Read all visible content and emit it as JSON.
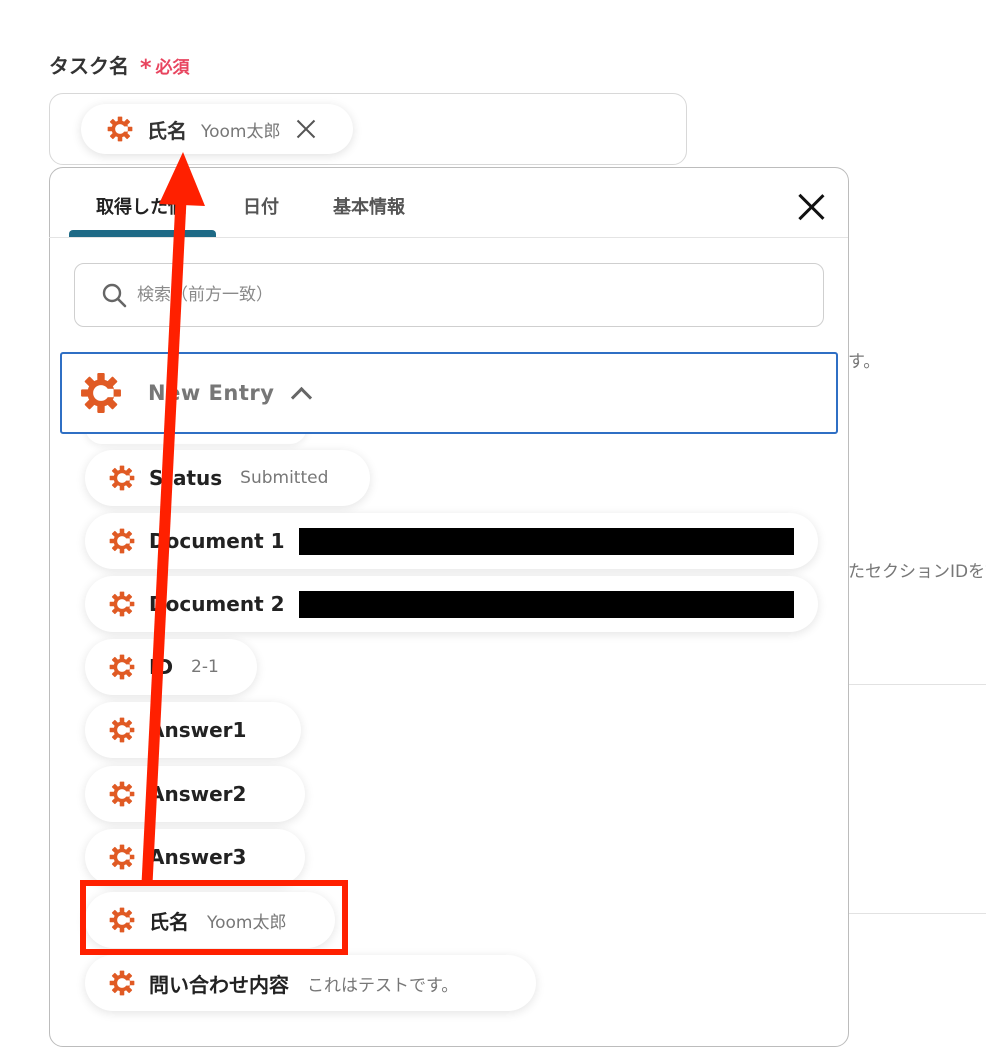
{
  "field": {
    "label": "タスク名",
    "required_mark": "*",
    "required_text": "必須",
    "chip": {
      "name": "氏名",
      "value": "Yoom太郎"
    }
  },
  "background": {
    "text1": "す。",
    "text2": "たセクションIDを設"
  },
  "panel": {
    "tabs": [
      {
        "label": "取得した値",
        "active": true
      },
      {
        "label": "日付",
        "active": false
      },
      {
        "label": "基本情報",
        "active": false
      }
    ],
    "search_placeholder": "検索（前方一致）",
    "group": {
      "title": "New Entry",
      "items": [
        {
          "name": "Status",
          "value": "Submitted"
        },
        {
          "name": "Document 1",
          "value": ""
        },
        {
          "name": "Document 2",
          "value": ""
        },
        {
          "name": "ID",
          "value": "2-1"
        },
        {
          "name": "Answer1",
          "value": ""
        },
        {
          "name": "Answer2",
          "value": ""
        },
        {
          "name": "Answer3",
          "value": ""
        },
        {
          "name": "氏名",
          "value": "Yoom太郎"
        },
        {
          "name": "問い合わせ内容",
          "value": "これはテストです。"
        }
      ]
    }
  },
  "icons": {
    "chip_icon": "gear-c-icon",
    "close": "close-icon",
    "search": "search-icon",
    "chevron": "chevron-up-icon"
  },
  "colors": {
    "accent_orange": "#e05a24",
    "required_red": "#e8455f",
    "tab_underline": "#1e6a86",
    "group_border": "#2f6fc4",
    "annotation_red": "#ff2000"
  }
}
